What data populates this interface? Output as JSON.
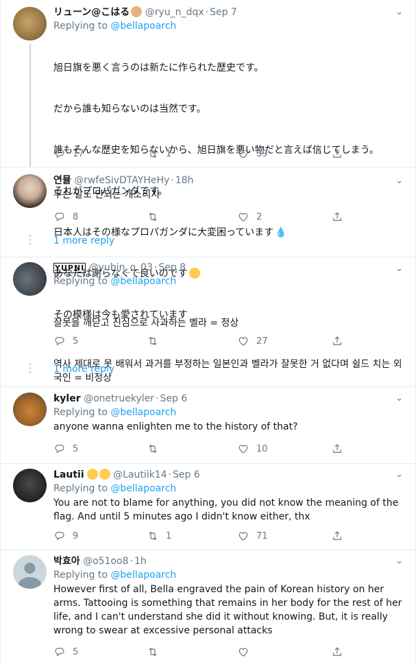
{
  "tweets": [
    {
      "name": "リューン@こはる",
      "handle": "@ryu_n_dqx",
      "time": "Sep 7",
      "reply_prefix": "Replying to ",
      "reply_to": "@bellapoarch",
      "text_lines": [
        "旭日旗を悪く言うのは新たに作られた歴史です。",
        "だから誰も知らないのは当然です。",
        "誰もそんな歴史を知らないから、旭日旗を悪い物だと言えば信じてしまう。",
        "それがプロパガンダです。",
        "日本人はその様なプロパガンダに大変困っています",
        "あなたは謝らなくて良いのです",
        "その模様は今も愛されています"
      ],
      "replies": "17",
      "retweets": "1",
      "likes": "39"
    },
    {
      "name": "연뮬",
      "handle": "@rwfeSivDTAYHeHy",
      "time": "18h",
      "text_lines": [
        "무슨 말도 안되는 개소리지"
      ],
      "replies": "8",
      "retweets": "",
      "likes": "2",
      "more_label": "1 more reply"
    },
    {
      "name": "YUPNI",
      "handle": "@yubin_o_03",
      "time": "Sep 8",
      "reply_prefix": "Replying to ",
      "reply_to": "@bellapoarch",
      "text_lines": [
        "잘못을 깨닫고 진심으로 사과하는 벨라 = 정상",
        "역사 제대로 못 배워서 과거를 부정하는 일본인과 벨라가 잘못한 거 없다며 쉴드 치는 외국인 = 비정상"
      ],
      "replies": "5",
      "retweets": "",
      "likes": "27",
      "more_label": "1 more reply"
    },
    {
      "name": "kyler",
      "handle": "@onetruekyler",
      "time": "Sep 6",
      "reply_prefix": "Replying to ",
      "reply_to": "@bellapoarch",
      "text_lines": [
        "anyone wanna enlighten me to the history of that?"
      ],
      "replies": "5",
      "retweets": "",
      "likes": "10"
    },
    {
      "name": "Lautii",
      "handle": "@Lautiik14",
      "time": "Sep 6",
      "reply_prefix": "Replying to ",
      "reply_to": "@bellapoarch",
      "text_lines": [
        "You are not to blame for anything, you did not know the meaning of the flag. And until 5 minutes ago I didn't know either, thx"
      ],
      "replies": "9",
      "retweets": "1",
      "likes": "71"
    },
    {
      "name": "박효아",
      "handle": "@o51oo8",
      "time": "1h",
      "reply_prefix": "Replying to ",
      "reply_to": "@bellapoarch",
      "text_lines": [
        "However first of all, Bella engraved the pain of Korean history on her arms. Tattooing is something that remains in her body for the rest of her life, and I can't understand she did it without knowing. But, it is really wrong to swear at excessive personal attacks"
      ],
      "replies": "5",
      "retweets": "",
      "likes": ""
    }
  ],
  "colors": {
    "accent": "#1da1f2",
    "muted": "#657786",
    "line": "#ccd6dd",
    "divider": "#e6ecf0"
  }
}
